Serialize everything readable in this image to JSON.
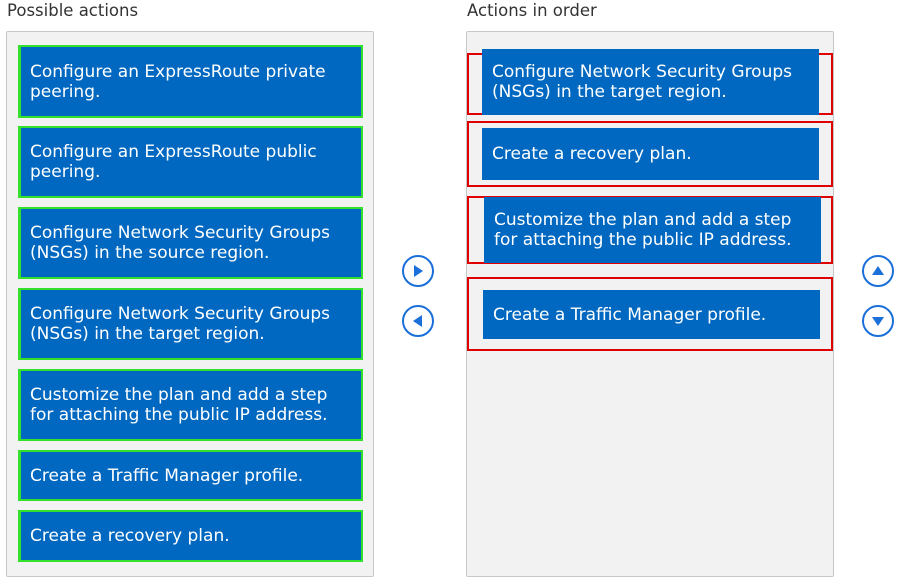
{
  "left_panel": {
    "title": "Possible actions",
    "items": [
      {
        "label": "Configure an ExpressRoute private peering."
      },
      {
        "label": "Configure an ExpressRoute public peering."
      },
      {
        "label": "Configure Network Security Groups (NSGs) in the source region."
      },
      {
        "label": "Configure Network Security Groups (NSGs) in the target region."
      },
      {
        "label": "Customize the plan and add a step for attaching the public IP address."
      },
      {
        "label": "Create a Traffic Manager profile."
      },
      {
        "label": "Create a recovery plan."
      }
    ]
  },
  "right_panel": {
    "title": "Actions in order",
    "items": [
      {
        "label": "Configure Network Security Groups (NSGs) in the target region."
      },
      {
        "label": "Create a recovery plan."
      },
      {
        "label": "Customize the plan and add a step for attaching the public IP address."
      },
      {
        "label": "Create a Traffic Manager profile."
      }
    ]
  },
  "controls": {
    "move_right_icon": "arrow-right-circle",
    "move_left_icon": "arrow-left-circle",
    "move_up_icon": "arrow-up-circle",
    "move_down_icon": "arrow-down-circle"
  },
  "colors": {
    "item_background": "#0068c0",
    "source_item_border": "#33e02b",
    "answer_slot_border": "#e00000",
    "control_blue": "#1a6fd9"
  }
}
